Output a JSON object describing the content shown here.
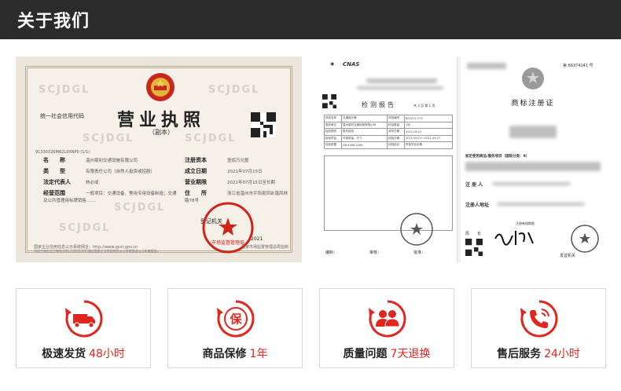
{
  "header": {
    "title": "关于我们"
  },
  "license": {
    "title": "营业执照",
    "subtitle": "（副本）",
    "code_label": "统一社会信用代码",
    "code_value": "91330326MA2L9XNP0 (1/1)",
    "watermark": "SCJDGL",
    "rows": [
      {
        "label": "名　　称",
        "value": "温州豪利交通设施有限公司"
      },
      {
        "label": "类　　型",
        "value": "有限责任公司（自然人投资或控股）"
      },
      {
        "label": "法定代表人",
        "value": "林必成"
      },
      {
        "label": "经营范围",
        "value": "一般项目：交通设备、警用专用设备制造；交通及公共管理用标牌销售……"
      }
    ],
    "right_rows": [
      {
        "label": "注册资本",
        "value": "壹佰万元整"
      },
      {
        "label": "成立日期",
        "value": "2021年07月15日"
      },
      {
        "label": "营业期限",
        "value": "2021年07月15日至长期"
      },
      {
        "label": "住　　所",
        "value": "浙江省温州市平阳县凤卧镇凤林路78号"
      }
    ],
    "authority": "登记机关",
    "year_mark": "2021",
    "seal_text": "市场监督管理局",
    "footer_left": "国家企业信用信息公示系统网址：http://www.gsxt.gov.cn",
    "footer_mid": "市场主体应当于每年1月1日至6月30日通过国家企业信用信息公示系统报送公示年度报告。",
    "footer_right": "国家市场监督管理总局监制"
  },
  "report": {
    "cnas": "CNAS",
    "title": "检测报告",
    "page_no": "共 3 页 第 1 页",
    "table": [
      [
        "样品名称",
        "交通指示牌",
        "样品编号",
        "BG2021-075"
      ],
      [
        "委托单位",
        "温州豪利交通设施有限公司",
        "样品数量",
        "1块"
      ],
      [
        "检验类别",
        "委托检验",
        "收样日期",
        "2021-09-21"
      ],
      [
        "检验项目",
        "外观质量、尺寸",
        "检验日期",
        "2021-09-21～2021-09-27"
      ],
      [
        "检验依据",
        "GB 5768-2009",
        "检验结论",
        "所检项目合格"
      ]
    ],
    "signers": [
      "编制：",
      "审核：",
      "批准："
    ]
  },
  "trademark": {
    "number": "第 66374141 号",
    "title": "商标注册证",
    "service": "核定使用商品/服务项目（国际分类：9）",
    "registrant_label": "注 册 人",
    "address_label": "注册人地址",
    "validity": "注册有效期限",
    "director": "局　　长",
    "authority": "发证机关"
  },
  "services": [
    {
      "name": "极速发货",
      "highlight": "48小时",
      "icon": "truck-icon"
    },
    {
      "name": "商品保修",
      "highlight": "1年",
      "icon": "warranty-icon"
    },
    {
      "name": "质量问题",
      "highlight": "7天退换",
      "icon": "return-icon"
    },
    {
      "name": "售后服务",
      "highlight": "24小时",
      "icon": "phone-icon"
    }
  ],
  "colors": {
    "accent": "#e0261f",
    "header_bg": "#2b2b2b"
  }
}
